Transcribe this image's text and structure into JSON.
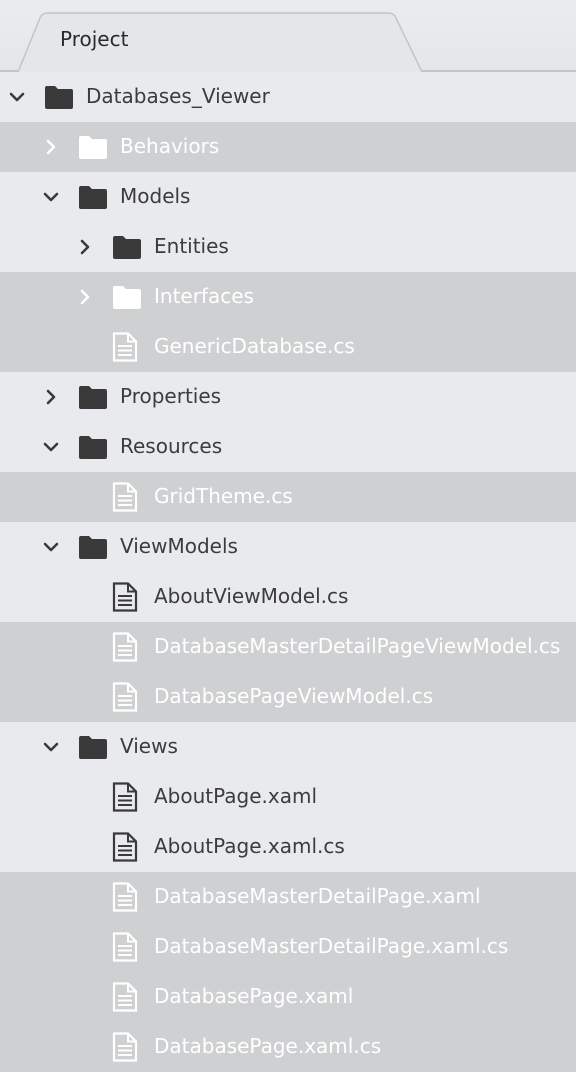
{
  "tab": {
    "label": "Project"
  },
  "tree": [
    {
      "label": "Databases_Viewer",
      "depth": 0,
      "kind": "folder",
      "expand": "expanded",
      "shade": "light"
    },
    {
      "label": "Behaviors",
      "depth": 1,
      "kind": "folder",
      "expand": "collapsed",
      "shade": "dark"
    },
    {
      "label": "Models",
      "depth": 1,
      "kind": "folder",
      "expand": "expanded",
      "shade": "light"
    },
    {
      "label": "Entities",
      "depth": 2,
      "kind": "folder",
      "expand": "collapsed",
      "shade": "light"
    },
    {
      "label": "Interfaces",
      "depth": 2,
      "kind": "folder",
      "expand": "collapsed",
      "shade": "dark"
    },
    {
      "label": "GenericDatabase.cs",
      "depth": 2,
      "kind": "file",
      "expand": "none",
      "shade": "dark"
    },
    {
      "label": "Properties",
      "depth": 1,
      "kind": "folder",
      "expand": "collapsed",
      "shade": "light"
    },
    {
      "label": "Resources",
      "depth": 1,
      "kind": "folder",
      "expand": "expanded",
      "shade": "light"
    },
    {
      "label": "GridTheme.cs",
      "depth": 2,
      "kind": "file",
      "expand": "none",
      "shade": "dark"
    },
    {
      "label": "ViewModels",
      "depth": 1,
      "kind": "folder",
      "expand": "expanded",
      "shade": "light"
    },
    {
      "label": "AboutViewModel.cs",
      "depth": 2,
      "kind": "file",
      "expand": "none",
      "shade": "light"
    },
    {
      "label": "DatabaseMasterDetailPageViewModel.cs",
      "depth": 2,
      "kind": "file",
      "expand": "none",
      "shade": "dark"
    },
    {
      "label": "DatabasePageViewModel.cs",
      "depth": 2,
      "kind": "file",
      "expand": "none",
      "shade": "dark"
    },
    {
      "label": "Views",
      "depth": 1,
      "kind": "folder",
      "expand": "expanded",
      "shade": "light"
    },
    {
      "label": "AboutPage.xaml",
      "depth": 2,
      "kind": "file",
      "expand": "none",
      "shade": "light"
    },
    {
      "label": "AboutPage.xaml.cs",
      "depth": 2,
      "kind": "file",
      "expand": "none",
      "shade": "light"
    },
    {
      "label": "DatabaseMasterDetailPage.xaml",
      "depth": 2,
      "kind": "file",
      "expand": "none",
      "shade": "dark"
    },
    {
      "label": "DatabaseMasterDetailPage.xaml.cs",
      "depth": 2,
      "kind": "file",
      "expand": "none",
      "shade": "dark"
    },
    {
      "label": "DatabasePage.xaml",
      "depth": 2,
      "kind": "file",
      "expand": "none",
      "shade": "dark"
    },
    {
      "label": "DatabasePage.xaml.cs",
      "depth": 2,
      "kind": "file",
      "expand": "none",
      "shade": "dark"
    }
  ],
  "colors": {
    "light_row": "#e8eaed",
    "dark_row": "#cfd0d2",
    "icon_dark": "#3a3a3a",
    "icon_light": "#ffffff"
  },
  "icons": {
    "folder": "folder-icon",
    "file": "file-icon",
    "expanded": "chevron-down-icon",
    "collapsed": "chevron-right-icon"
  }
}
